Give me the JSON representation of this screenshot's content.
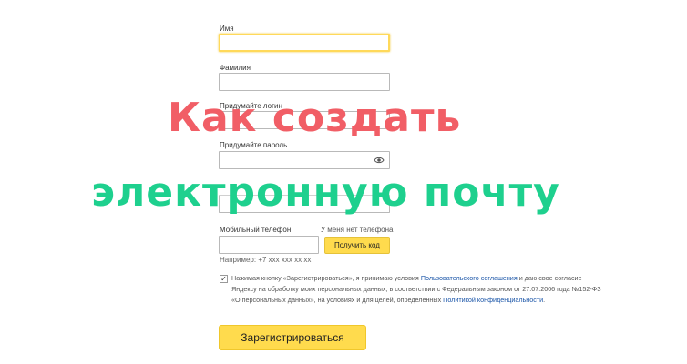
{
  "form": {
    "first_name_label": "Имя",
    "first_name_value": "",
    "last_name_label": "Фамилия",
    "last_name_value": "",
    "login_label": "Придумайте логин",
    "login_value": "",
    "password_label": "Придумайте пароль",
    "password_value": "",
    "confirm_value": "",
    "phone_label": "Мобильный телефон",
    "phone_value": "",
    "no_phone_link": "У меня нет телефона",
    "get_code_button": "Получить код",
    "phone_hint": "Например: +7 xxx xxx xx xx",
    "agreement": {
      "checked": true,
      "text_1": "Нажимая кнопку «Зарегистрироваться», я принимаю условия ",
      "link_1": "Пользовательского соглашения",
      "text_2": " и даю свое согласие Яндексу на обработку моих персональных данных, в соответствии с Федеральным законом от 27.07.2006 года №152-ФЗ «О персональных данных», на условиях и для целей, определенных ",
      "link_2": "Политикой конфиденциальности",
      "text_3": "."
    },
    "register_button": "Зарегистрироваться"
  },
  "overlay": {
    "line_1": "Как создать",
    "line_2": "электронную почту"
  },
  "colors": {
    "accent_yellow": "#ffdb4d",
    "overlay_red": "#f15e66",
    "overlay_green": "#1ed08e",
    "link_blue": "#1a55a8"
  },
  "icons": {
    "password_toggle": "eye-icon",
    "checkbox_mark": "checkmark-icon"
  }
}
